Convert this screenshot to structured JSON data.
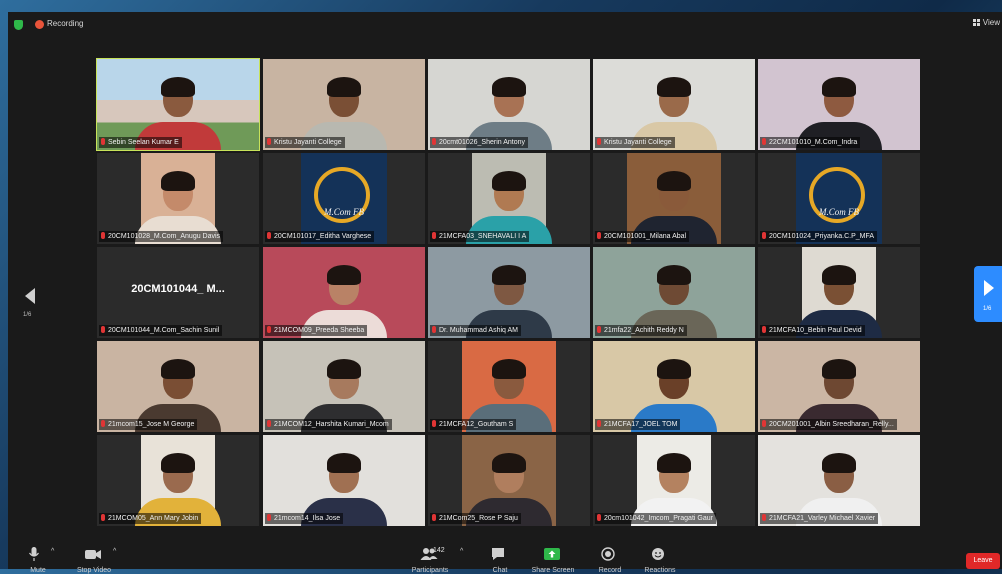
{
  "topbar": {
    "recording_label": "Recording",
    "view_label": "View"
  },
  "tiles": [
    {
      "name": "Sebin Seelan Kumar E",
      "kind": "room",
      "bg": "#9fb7c8",
      "skin": "#8a5a3e",
      "shirt": "#c13a3a",
      "active": true
    },
    {
      "name": "Kristu Jayanti College",
      "kind": "person",
      "bg": "#c8b4a2",
      "skin": "#7a4f35",
      "shirt": "#b8b8b0"
    },
    {
      "name": "20cmt01026_Sherin Antony",
      "kind": "person",
      "bg": "#d6d6d2",
      "skin": "#a87254",
      "shirt": "#6e7d86"
    },
    {
      "name": "Kristu Jayanti College",
      "kind": "person",
      "bg": "#dcdcd8",
      "skin": "#9a6a4a",
      "shirt": "#d9c8a6"
    },
    {
      "name": "22CM101010_M.Com_Indra",
      "kind": "person",
      "bg": "#d2c4d0",
      "skin": "#8e5a40",
      "shirt": "#1f1f24"
    },
    {
      "name": "20CM101028_M.Com_Anugu Davis",
      "kind": "narrow",
      "bg": "#d9b196",
      "skin": "#c48a6a",
      "shirt": "#e8ddd2"
    },
    {
      "name": "20CM101017_Editha Varghese",
      "kind": "logo",
      "logo_text": "M.Com FB"
    },
    {
      "name": "21MCFA03_SNEHAVALI I A",
      "kind": "narrow",
      "bg": "#bcbcb2",
      "skin": "#b07a52",
      "shirt": "#2aa1a8"
    },
    {
      "name": "20CM101001_Milana Abal",
      "kind": "mid",
      "bg": "#8a5d3a",
      "skin": "#8a5a3a",
      "shirt": "#1f2430"
    },
    {
      "name": "20CM101024_Priyanka.C.P_MFA",
      "kind": "logo",
      "logo_text": "M.Com FB"
    },
    {
      "name": "20CM101044_M.Com_Sachin Sunil",
      "kind": "text",
      "tile_text": "20CM101044_ M..."
    },
    {
      "name": "21MCOM09_Preeda Sheeba",
      "kind": "person",
      "bg": "#b84a5a",
      "skin": "#b98266",
      "shirt": "#ecdcd8"
    },
    {
      "name": "Dr. Muhammad Ashiq AM",
      "kind": "person",
      "bg": "#8d9aa2",
      "skin": "#7e5842",
      "shirt": "#2e3a48"
    },
    {
      "name": "21mfa22_Achith Reddy N",
      "kind": "person",
      "bg": "#8ea39a",
      "skin": "#6e4a34",
      "shirt": "#6a6658"
    },
    {
      "name": "21MCFA10_Bebin Paul Devid",
      "kind": "narrow",
      "bg": "#dedad2",
      "skin": "#7a5034",
      "shirt": "#1e2b44"
    },
    {
      "name": "21mcom15_Jose M George",
      "kind": "person",
      "bg": "#c9b4a2",
      "skin": "#7a4e34",
      "shirt": "#4a3a30"
    },
    {
      "name": "21MCOM12_Harshita Kumari_Mcom",
      "kind": "person",
      "bg": "#c6c2b8",
      "skin": "#a77a5e",
      "shirt": "#2e2e30"
    },
    {
      "name": "21MCFA12_Goutham S",
      "kind": "mid",
      "bg": "#d96a44",
      "skin": "#8a5a3e",
      "shirt": "#5a6e7a"
    },
    {
      "name": "21MCFA17_JOEL TOM",
      "kind": "person",
      "bg": "#d8c8a6",
      "skin": "#6a4028",
      "shirt": "#2a7ac8"
    },
    {
      "name": "20CM201001_Albin Sreedharan_Relly...",
      "kind": "person",
      "bg": "#cbb6a4",
      "skin": "#6e4832",
      "shirt": "#3a2a30"
    },
    {
      "name": "21MCOM05_Ann Mary Jobin",
      "kind": "narrow",
      "bg": "#e8e2d8",
      "skin": "#9a6a4e",
      "shirt": "#e2b23a"
    },
    {
      "name": "21mcom14_Ilsa Jose",
      "kind": "person",
      "bg": "#e2e0dc",
      "skin": "#a07052",
      "shirt": "#2a3048"
    },
    {
      "name": "21MCom25_Rose P Saju",
      "kind": "mid",
      "bg": "#8a6446",
      "skin": "#b07e5e",
      "shirt": "#2e2a30"
    },
    {
      "name": "20cm101042_Imcom_Pragati Gaur",
      "kind": "narrow",
      "bg": "#ecebe6",
      "skin": "#b48260",
      "shirt": "#f2f2f2"
    },
    {
      "name": "21MCFA21_Varley Michael Xavier",
      "kind": "person",
      "bg": "#e4e2de",
      "skin": "#8a5e44",
      "shirt": "#f0f0f0"
    }
  ],
  "pagination": {
    "left_label": "1/6",
    "right_label": "1/6"
  },
  "toolbar": {
    "mute_label": "Mute",
    "video_label": "Stop Video",
    "participants_label": "Participants",
    "participants_count": "142",
    "chat_label": "Chat",
    "share_label": "Share Screen",
    "record_label": "Record",
    "reactions_label": "Reactions",
    "leave_label": "Leave",
    "share_color": "#2fb84a",
    "leave_color": "#e02828"
  }
}
